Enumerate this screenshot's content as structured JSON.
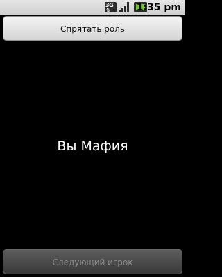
{
  "status_bar": {
    "network_label": "3G",
    "signal_icon": "signal-bars-icon",
    "battery_icon": "battery-charging-icon",
    "time": "1:35 pm"
  },
  "main": {
    "hide_role_button": "Спрятать роль",
    "role_text": "Вы Мафия",
    "next_player_button": "Следующий игрок"
  }
}
